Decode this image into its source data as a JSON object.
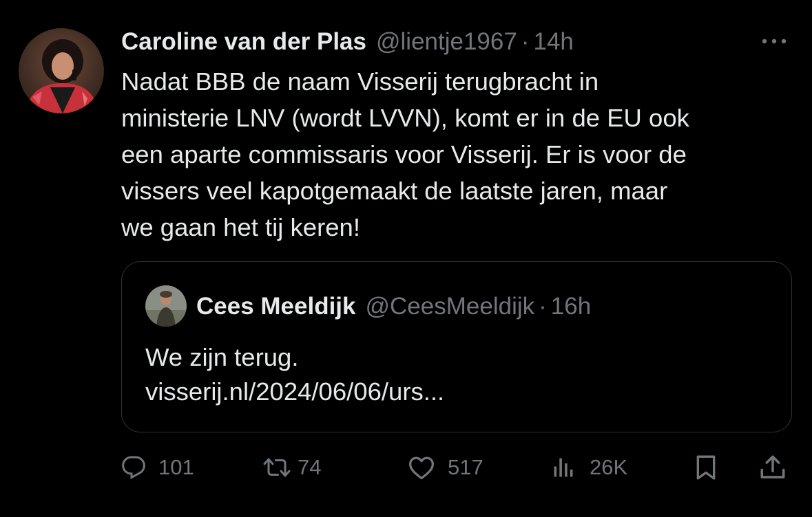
{
  "post": {
    "author_name": "Caroline van der Plas",
    "handle": "@lientje1967",
    "separator": "·",
    "time": "14h",
    "text_lines": [
      "Nadat BBB de naam Visserij terugbracht in",
      "ministerie LNV (wordt LVVN), komt er in de EU ook",
      "een aparte commissaris voor Visserij. Er is voor de",
      "vissers veel kapotgemaakt de laatste jaren, maar",
      "we gaan het tij keren!"
    ],
    "more_icon": "ellipsis-icon"
  },
  "quote": {
    "author_name": "Cees Meeldijk",
    "handle": "@CeesMeeldijk",
    "separator": "·",
    "time": "16h",
    "text_lines": [
      "We zijn terug.",
      "visserij.nl/2024/06/06/urs..."
    ]
  },
  "actions": {
    "replies": {
      "icon": "reply-icon",
      "count": "101"
    },
    "reposts": {
      "icon": "repost-icon",
      "count": "74"
    },
    "likes": {
      "icon": "heart-icon",
      "count": "517"
    },
    "views": {
      "icon": "views-icon",
      "count": "26K"
    },
    "bookmark": {
      "icon": "bookmark-icon"
    },
    "share": {
      "icon": "share-icon"
    }
  },
  "colors": {
    "background": "#000000",
    "text_primary": "#e7e9ea",
    "text_secondary": "#71767b",
    "border": "#2f3336"
  }
}
